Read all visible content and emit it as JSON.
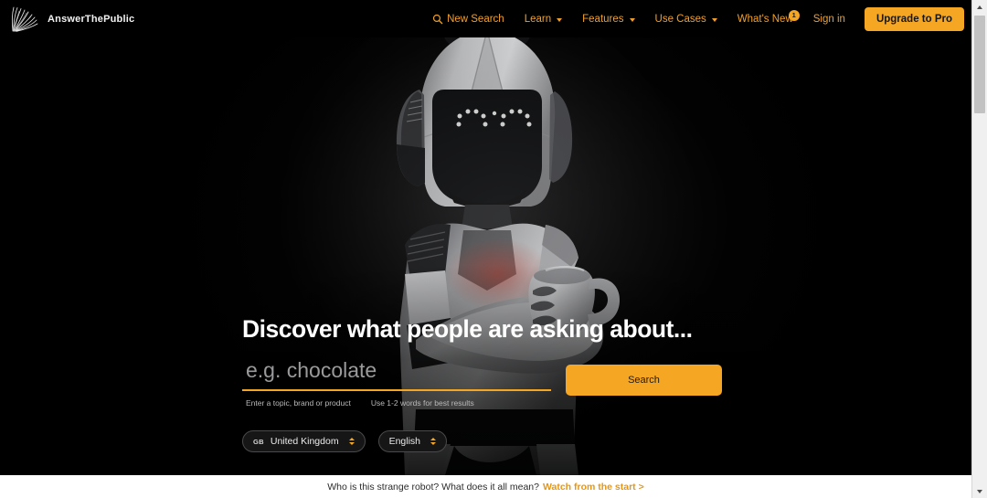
{
  "brand": {
    "name": "AnswerThePublic",
    "logo_icon": "seedhead-logo-icon"
  },
  "nav": {
    "new_search": {
      "label": "New Search",
      "icon": "search-icon"
    },
    "items": [
      {
        "label": "Learn",
        "has_caret": true
      },
      {
        "label": "Features",
        "has_caret": true
      },
      {
        "label": "Use Cases",
        "has_caret": true
      }
    ],
    "whats_new": {
      "label": "What's New",
      "badge": "1"
    },
    "sign_in": {
      "label": "Sign in"
    },
    "upgrade": {
      "label": "Upgrade to Pro"
    }
  },
  "hero": {
    "headline": "Discover what people are asking about...",
    "search": {
      "value": "",
      "placeholder": "e.g. chocolate",
      "button_label": "Search"
    },
    "hints": [
      "Enter a topic, brand or product",
      "Use 1-2 words for best results"
    ],
    "country_select": {
      "code": "GB",
      "label": "United Kingdom"
    },
    "language_select": {
      "label": "English"
    },
    "background_image": "robot-holding-mug"
  },
  "footer": {
    "text": "Who is this strange robot? What does it all mean?",
    "link": "Watch from the start >"
  },
  "scrollbar": {
    "up_icon": "chevron-up-icon",
    "down_icon": "chevron-down-icon"
  },
  "colors": {
    "accent": "#f5a623",
    "accent_text": "#f0a02a",
    "hero_bg": "#000000",
    "footer_bg": "#ffffff"
  }
}
